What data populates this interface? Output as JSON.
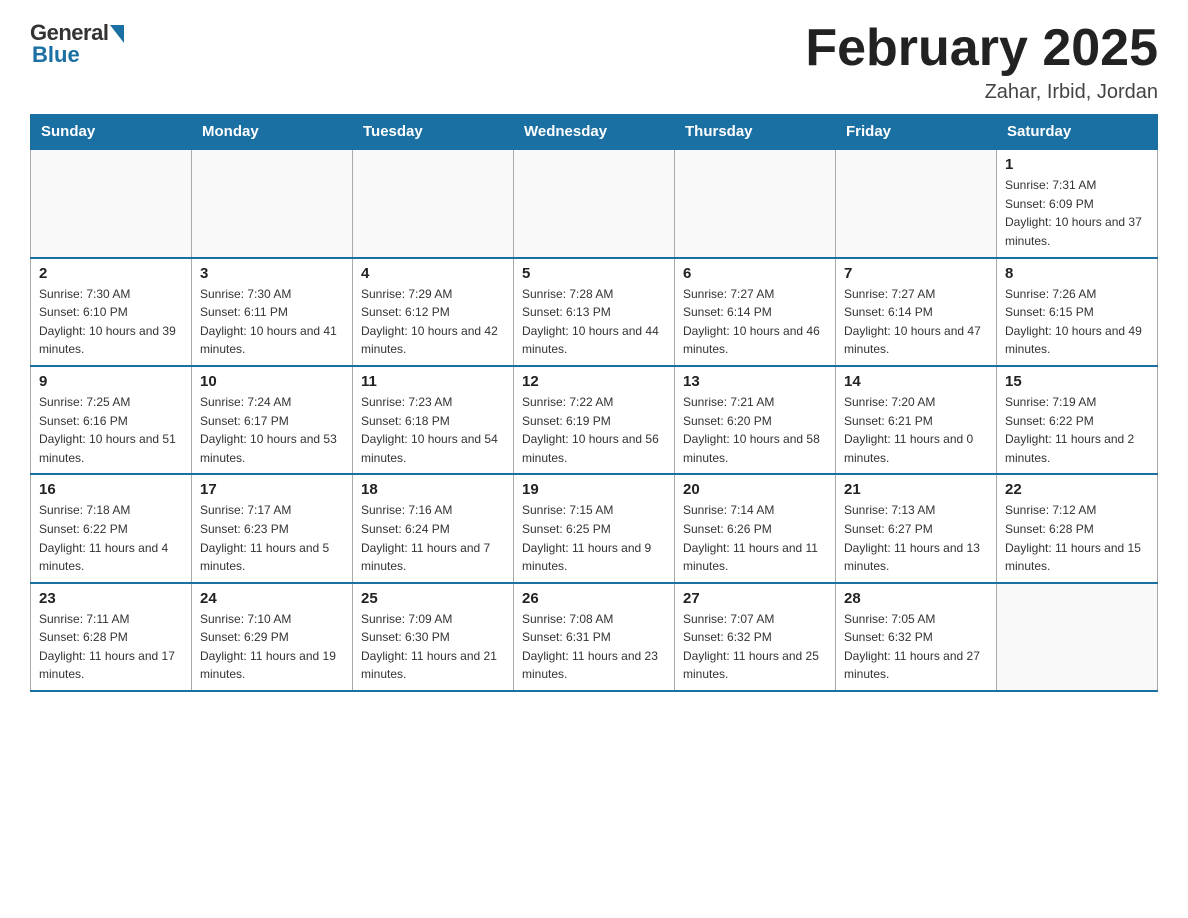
{
  "header": {
    "logo": {
      "general": "General",
      "blue": "Blue"
    },
    "title": "February 2025",
    "location": "Zahar, Irbid, Jordan"
  },
  "weekdays": [
    "Sunday",
    "Monday",
    "Tuesday",
    "Wednesday",
    "Thursday",
    "Friday",
    "Saturday"
  ],
  "weeks": [
    [
      {
        "day": "",
        "sunrise": "",
        "sunset": "",
        "daylight": ""
      },
      {
        "day": "",
        "sunrise": "",
        "sunset": "",
        "daylight": ""
      },
      {
        "day": "",
        "sunrise": "",
        "sunset": "",
        "daylight": ""
      },
      {
        "day": "",
        "sunrise": "",
        "sunset": "",
        "daylight": ""
      },
      {
        "day": "",
        "sunrise": "",
        "sunset": "",
        "daylight": ""
      },
      {
        "day": "",
        "sunrise": "",
        "sunset": "",
        "daylight": ""
      },
      {
        "day": "1",
        "sunrise": "Sunrise: 7:31 AM",
        "sunset": "Sunset: 6:09 PM",
        "daylight": "Daylight: 10 hours and 37 minutes."
      }
    ],
    [
      {
        "day": "2",
        "sunrise": "Sunrise: 7:30 AM",
        "sunset": "Sunset: 6:10 PM",
        "daylight": "Daylight: 10 hours and 39 minutes."
      },
      {
        "day": "3",
        "sunrise": "Sunrise: 7:30 AM",
        "sunset": "Sunset: 6:11 PM",
        "daylight": "Daylight: 10 hours and 41 minutes."
      },
      {
        "day": "4",
        "sunrise": "Sunrise: 7:29 AM",
        "sunset": "Sunset: 6:12 PM",
        "daylight": "Daylight: 10 hours and 42 minutes."
      },
      {
        "day": "5",
        "sunrise": "Sunrise: 7:28 AM",
        "sunset": "Sunset: 6:13 PM",
        "daylight": "Daylight: 10 hours and 44 minutes."
      },
      {
        "day": "6",
        "sunrise": "Sunrise: 7:27 AM",
        "sunset": "Sunset: 6:14 PM",
        "daylight": "Daylight: 10 hours and 46 minutes."
      },
      {
        "day": "7",
        "sunrise": "Sunrise: 7:27 AM",
        "sunset": "Sunset: 6:14 PM",
        "daylight": "Daylight: 10 hours and 47 minutes."
      },
      {
        "day": "8",
        "sunrise": "Sunrise: 7:26 AM",
        "sunset": "Sunset: 6:15 PM",
        "daylight": "Daylight: 10 hours and 49 minutes."
      }
    ],
    [
      {
        "day": "9",
        "sunrise": "Sunrise: 7:25 AM",
        "sunset": "Sunset: 6:16 PM",
        "daylight": "Daylight: 10 hours and 51 minutes."
      },
      {
        "day": "10",
        "sunrise": "Sunrise: 7:24 AM",
        "sunset": "Sunset: 6:17 PM",
        "daylight": "Daylight: 10 hours and 53 minutes."
      },
      {
        "day": "11",
        "sunrise": "Sunrise: 7:23 AM",
        "sunset": "Sunset: 6:18 PM",
        "daylight": "Daylight: 10 hours and 54 minutes."
      },
      {
        "day": "12",
        "sunrise": "Sunrise: 7:22 AM",
        "sunset": "Sunset: 6:19 PM",
        "daylight": "Daylight: 10 hours and 56 minutes."
      },
      {
        "day": "13",
        "sunrise": "Sunrise: 7:21 AM",
        "sunset": "Sunset: 6:20 PM",
        "daylight": "Daylight: 10 hours and 58 minutes."
      },
      {
        "day": "14",
        "sunrise": "Sunrise: 7:20 AM",
        "sunset": "Sunset: 6:21 PM",
        "daylight": "Daylight: 11 hours and 0 minutes."
      },
      {
        "day": "15",
        "sunrise": "Sunrise: 7:19 AM",
        "sunset": "Sunset: 6:22 PM",
        "daylight": "Daylight: 11 hours and 2 minutes."
      }
    ],
    [
      {
        "day": "16",
        "sunrise": "Sunrise: 7:18 AM",
        "sunset": "Sunset: 6:22 PM",
        "daylight": "Daylight: 11 hours and 4 minutes."
      },
      {
        "day": "17",
        "sunrise": "Sunrise: 7:17 AM",
        "sunset": "Sunset: 6:23 PM",
        "daylight": "Daylight: 11 hours and 5 minutes."
      },
      {
        "day": "18",
        "sunrise": "Sunrise: 7:16 AM",
        "sunset": "Sunset: 6:24 PM",
        "daylight": "Daylight: 11 hours and 7 minutes."
      },
      {
        "day": "19",
        "sunrise": "Sunrise: 7:15 AM",
        "sunset": "Sunset: 6:25 PM",
        "daylight": "Daylight: 11 hours and 9 minutes."
      },
      {
        "day": "20",
        "sunrise": "Sunrise: 7:14 AM",
        "sunset": "Sunset: 6:26 PM",
        "daylight": "Daylight: 11 hours and 11 minutes."
      },
      {
        "day": "21",
        "sunrise": "Sunrise: 7:13 AM",
        "sunset": "Sunset: 6:27 PM",
        "daylight": "Daylight: 11 hours and 13 minutes."
      },
      {
        "day": "22",
        "sunrise": "Sunrise: 7:12 AM",
        "sunset": "Sunset: 6:28 PM",
        "daylight": "Daylight: 11 hours and 15 minutes."
      }
    ],
    [
      {
        "day": "23",
        "sunrise": "Sunrise: 7:11 AM",
        "sunset": "Sunset: 6:28 PM",
        "daylight": "Daylight: 11 hours and 17 minutes."
      },
      {
        "day": "24",
        "sunrise": "Sunrise: 7:10 AM",
        "sunset": "Sunset: 6:29 PM",
        "daylight": "Daylight: 11 hours and 19 minutes."
      },
      {
        "day": "25",
        "sunrise": "Sunrise: 7:09 AM",
        "sunset": "Sunset: 6:30 PM",
        "daylight": "Daylight: 11 hours and 21 minutes."
      },
      {
        "day": "26",
        "sunrise": "Sunrise: 7:08 AM",
        "sunset": "Sunset: 6:31 PM",
        "daylight": "Daylight: 11 hours and 23 minutes."
      },
      {
        "day": "27",
        "sunrise": "Sunrise: 7:07 AM",
        "sunset": "Sunset: 6:32 PM",
        "daylight": "Daylight: 11 hours and 25 minutes."
      },
      {
        "day": "28",
        "sunrise": "Sunrise: 7:05 AM",
        "sunset": "Sunset: 6:32 PM",
        "daylight": "Daylight: 11 hours and 27 minutes."
      },
      {
        "day": "",
        "sunrise": "",
        "sunset": "",
        "daylight": ""
      }
    ]
  ]
}
